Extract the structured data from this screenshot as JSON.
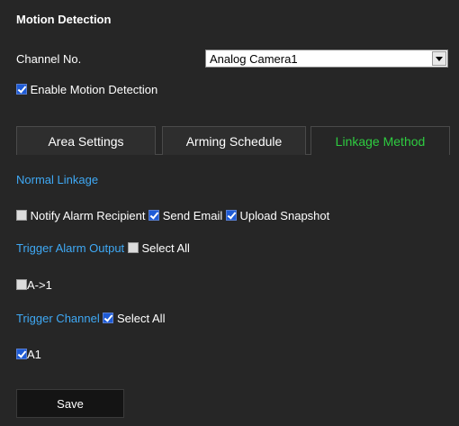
{
  "section_title": "Motion Detection",
  "channel": {
    "label": "Channel No.",
    "value": "Analog Camera1"
  },
  "enable_motion": {
    "label": "Enable Motion Detection",
    "checked": true
  },
  "tabs": [
    {
      "label": "Area Settings",
      "active": false
    },
    {
      "label": "Arming Schedule",
      "active": false
    },
    {
      "label": "Linkage Method",
      "active": true
    }
  ],
  "normal_linkage": {
    "title": "Normal Linkage",
    "options": [
      {
        "label": "Notify Alarm Recipient",
        "checked": false
      },
      {
        "label": "Send Email",
        "checked": true
      },
      {
        "label": "Upload Snapshot",
        "checked": true
      }
    ]
  },
  "trigger_alarm_output": {
    "title": "Trigger Alarm Output",
    "select_all_label": "Select All",
    "select_all_checked": false,
    "items": [
      {
        "label": "A->1",
        "checked": false
      }
    ]
  },
  "trigger_channel": {
    "title": "Trigger Channel",
    "select_all_label": "Select All",
    "select_all_checked": true,
    "items": [
      {
        "label": "A1",
        "checked": true
      }
    ]
  },
  "save_label": "Save",
  "colors": {
    "accent_blue": "#3fa9f5",
    "active_tab": "#2ecc40",
    "background": "#262626"
  }
}
